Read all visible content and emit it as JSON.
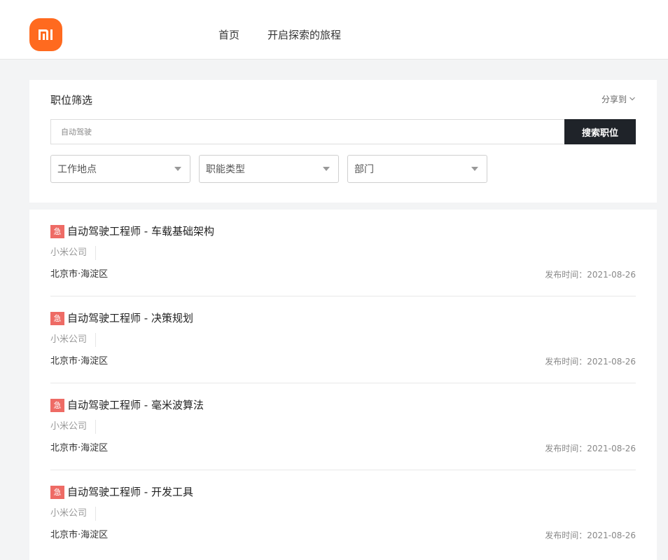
{
  "header": {
    "brand_icon": "mi-logo",
    "brand_color": "#ff6a1f",
    "nav": [
      {
        "label": "首页"
      },
      {
        "label": "开启探索的旅程"
      }
    ]
  },
  "filter": {
    "title": "职位筛选",
    "share_label": "分享到",
    "search": {
      "value": "",
      "placeholder": "自动驾驶",
      "button_label": "搜索职位"
    },
    "selects": [
      {
        "label": "工作地点"
      },
      {
        "label": "职能类型"
      },
      {
        "label": "部门"
      }
    ]
  },
  "jobs": [
    {
      "badge": "急",
      "title": "自动驾驶工程师 - 车载基础架构",
      "company": "小米公司",
      "location": "北京市·海淀区",
      "published": "发布时间：2021-08-26"
    },
    {
      "badge": "急",
      "title": "自动驾驶工程师 - 决策规划",
      "company": "小米公司",
      "location": "北京市·海淀区",
      "published": "发布时间：2021-08-26"
    },
    {
      "badge": "急",
      "title": "自动驾驶工程师 - 毫米波算法",
      "company": "小米公司",
      "location": "北京市·海淀区",
      "published": "发布时间：2021-08-26"
    },
    {
      "badge": "急",
      "title": "自动驾驶工程师 - 开发工具",
      "company": "小米公司",
      "location": "北京市·海淀区",
      "published": "发布时间：2021-08-26"
    }
  ],
  "colors": {
    "urgent": "#ee6b65",
    "search_button": "#1f2329"
  }
}
